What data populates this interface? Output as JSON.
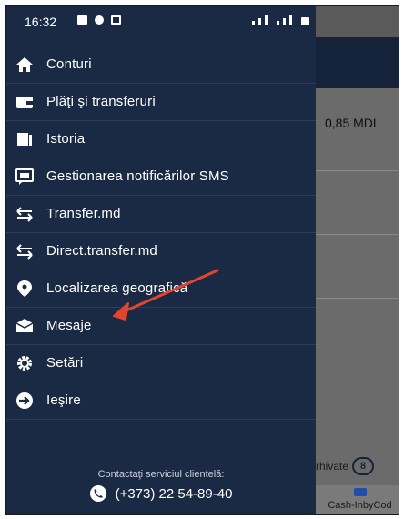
{
  "status_bar": {
    "time": "16:32"
  },
  "background_app": {
    "amount": "0,85 MDL",
    "archive_label": "rhivate",
    "archive_count": "8",
    "tab_label": "Cash-InbyCod"
  },
  "menu": {
    "items": [
      {
        "label": "Conturi",
        "icon": "home-icon"
      },
      {
        "label": "Plăţi şi transferuri",
        "icon": "wallet-icon"
      },
      {
        "label": "Istoria",
        "icon": "history-icon"
      },
      {
        "label": "Gestionarea notificărilor SMS",
        "icon": "sms-icon"
      },
      {
        "label": "Transfer.md",
        "icon": "transfer-icon"
      },
      {
        "label": "Direct.transfer.md",
        "icon": "transfer-icon"
      },
      {
        "label": "Localizarea geografică",
        "icon": "location-pin-icon"
      },
      {
        "label": "Mesaje",
        "icon": "mail-icon"
      },
      {
        "label": "Setări",
        "icon": "gear-icon"
      },
      {
        "label": "Ieşire",
        "icon": "exit-arrow-icon"
      }
    ]
  },
  "footer": {
    "contact_label": "Contactaţi serviciul clientelă:",
    "phone": "(+373) 22 54-89-40"
  },
  "annotation": {
    "arrow_color": "#e0462e",
    "points_to": "Mesaje"
  },
  "colors": {
    "drawer_bg": "#1b2a44",
    "header_bg": "#15233a"
  }
}
